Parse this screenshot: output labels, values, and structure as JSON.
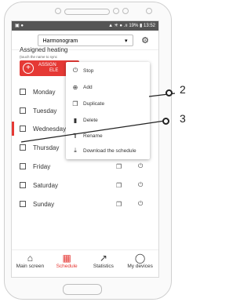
{
  "status": {
    "left": "▣ ●",
    "right": "▲ ✳ ● .ıı 19% ▮ 13:52"
  },
  "header": {
    "program": "Harmonogram",
    "dropdown_arrow": "▾",
    "settings_icon": "gear-icon"
  },
  "main": {
    "title": "Assigned heating",
    "hint": "(touch the name to sync",
    "assign_label": "ASSIGN",
    "assign_label2": "ELE"
  },
  "days": [
    {
      "label": "Monday"
    },
    {
      "label": "Tuesday"
    },
    {
      "label": "Wednesday"
    },
    {
      "label": "Thursday"
    },
    {
      "label": "Friday"
    },
    {
      "label": "Saturday"
    },
    {
      "label": "Sunday"
    }
  ],
  "menu": {
    "items": [
      {
        "label": "Stop",
        "icon": "power-icon"
      },
      {
        "label": "Add",
        "icon": "add-circle-icon"
      },
      {
        "label": "Duplicate",
        "icon": "duplicate-icon"
      },
      {
        "label": "Delete",
        "icon": "trash-icon"
      },
      {
        "label": "Rename",
        "icon": "text-icon"
      },
      {
        "label": "Download the schedule",
        "icon": "download-icon"
      }
    ]
  },
  "nav": {
    "items": [
      {
        "label": "Main screen",
        "icon": "home-icon"
      },
      {
        "label": "Schedule",
        "icon": "calendar-icon",
        "selected": true
      },
      {
        "label": "Statistics",
        "icon": "chart-icon"
      },
      {
        "label": "My devices",
        "icon": "device-icon"
      }
    ]
  },
  "callouts": {
    "c2": "2",
    "c3": "3"
  },
  "colors": {
    "accent": "#e53935"
  }
}
